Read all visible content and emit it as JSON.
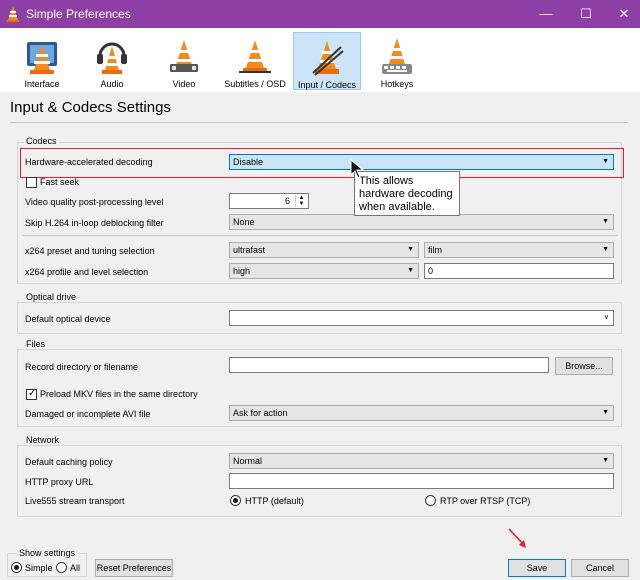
{
  "window": {
    "title": "Simple Preferences",
    "minimize": "—",
    "maximize": "☐",
    "close": "✕"
  },
  "toolbar": {
    "items": [
      {
        "label": "Interface"
      },
      {
        "label": "Audio"
      },
      {
        "label": "Video"
      },
      {
        "label": "Subtitles / OSD"
      },
      {
        "label": "Input / Codecs"
      },
      {
        "label": "Hotkeys"
      }
    ],
    "active_index": 4
  },
  "page_title": "Input & Codecs Settings",
  "codecs": {
    "title": "Codecs",
    "hw_decoding": {
      "label": "Hardware-accelerated decoding",
      "value": "Disable"
    },
    "fast_seek": {
      "label": "Fast seek",
      "checked": false
    },
    "post_processing": {
      "label": "Video quality post-processing level",
      "value": "6"
    },
    "skip_h264": {
      "label": "Skip H.264 in-loop deblocking filter",
      "value": "None"
    },
    "x264_preset": {
      "label": "x264 preset and tuning selection",
      "preset": "ultrafast",
      "tune": "film"
    },
    "x264_profile": {
      "label": "x264 profile and level selection",
      "profile": "high",
      "level": "0"
    }
  },
  "tooltip": {
    "text": "This allows hardware decoding when available."
  },
  "optical": {
    "title": "Optical drive",
    "device": {
      "label": "Default optical device",
      "value": ""
    }
  },
  "files": {
    "title": "Files",
    "record": {
      "label": "Record directory or filename",
      "value": "",
      "browse": "Browse..."
    },
    "preload_mkv": {
      "label": "Preload MKV files in the same directory",
      "checked": true
    },
    "damaged_avi": {
      "label": "Damaged or incomplete AVI file",
      "value": "Ask for action"
    }
  },
  "network": {
    "title": "Network",
    "caching": {
      "label": "Default caching policy",
      "value": "Normal"
    },
    "proxy": {
      "label": "HTTP proxy URL",
      "value": ""
    },
    "live555": {
      "label": "Live555 stream transport",
      "http": "HTTP (default)",
      "rtp": "RTP over RTSP (TCP)",
      "selected": "http"
    }
  },
  "footer": {
    "show_settings": "Show settings",
    "simple": "Simple",
    "all": "All",
    "reset": "Reset Preferences",
    "save": "Save",
    "cancel": "Cancel"
  },
  "colors": {
    "titlebar": "#8e3fa6",
    "highlight": "#e0202a",
    "selection": "#cce4f7"
  }
}
